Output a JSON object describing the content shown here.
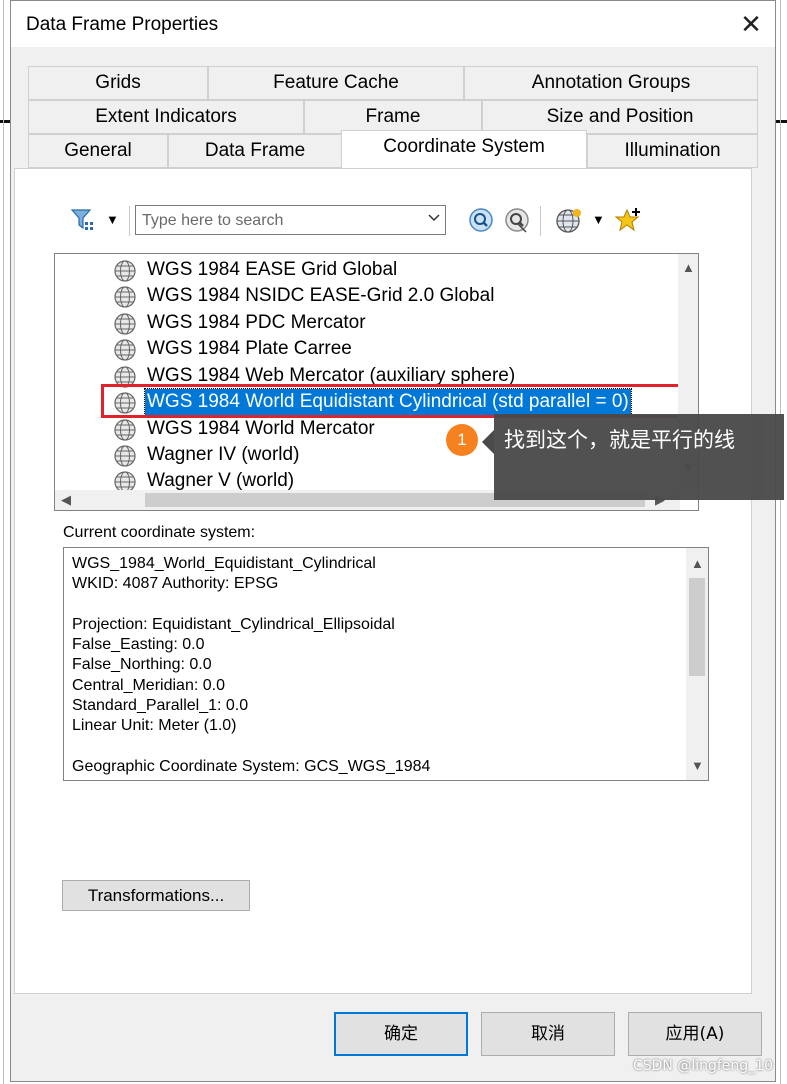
{
  "window": {
    "title": "Data Frame Properties",
    "close_glyph": "✕"
  },
  "tabs": {
    "row1": [
      "Grids",
      "Feature Cache",
      "Annotation Groups"
    ],
    "row2": [
      "Extent Indicators",
      "Frame",
      "Size and Position"
    ],
    "row3": [
      "General",
      "Data Frame",
      "Coordinate System",
      "Illumination"
    ],
    "active": "Coordinate System"
  },
  "toolbar": {
    "filter_icon": "filter-icon",
    "search_placeholder": "Type here to search",
    "search_icon": "search-icon",
    "clear_search_icon": "clear-search-icon",
    "add_globe_icon": "globe-add-icon",
    "favorite_icon": "star-add-icon"
  },
  "cs_list": {
    "items": [
      "WGS 1984 EASE Grid Global",
      "WGS 1984 NSIDC EASE-Grid 2.0 Global",
      "WGS 1984 PDC Mercator",
      "WGS 1984 Plate Carree",
      "WGS 1984 Web Mercator (auxiliary sphere)",
      "WGS 1984 World Equidistant Cylindrical (std parallel = 0)",
      "WGS 1984 World Mercator",
      "Wagner IV (world)",
      "Wagner V (world)"
    ],
    "selected": "WGS 1984 World Equidistant Cylindrical (std parallel = 0)"
  },
  "annotation": {
    "number": "1",
    "text": "找到这个，就是平行的线"
  },
  "current": {
    "label": "Current coordinate system:",
    "lines": [
      "WGS_1984_World_Equidistant_Cylindrical",
      "WKID: 4087 Authority: EPSG",
      "",
      "Projection: Equidistant_Cylindrical_Ellipsoidal",
      "False_Easting: 0.0",
      "False_Northing: 0.0",
      "Central_Meridian: 0.0",
      "Standard_Parallel_1: 0.0",
      "Linear Unit: Meter (1.0)",
      "",
      "Geographic Coordinate System: GCS_WGS_1984"
    ]
  },
  "buttons": {
    "transformations": "Transformations...",
    "ok": "确定",
    "cancel": "取消",
    "apply": "应用(A)"
  },
  "watermark": "CSDN @lingfeng_10",
  "colors": {
    "selection": "#0078d7",
    "highlight_box": "#e0222a",
    "callout_num": "#f5821f",
    "callout_bg": "#4a4a4a"
  }
}
